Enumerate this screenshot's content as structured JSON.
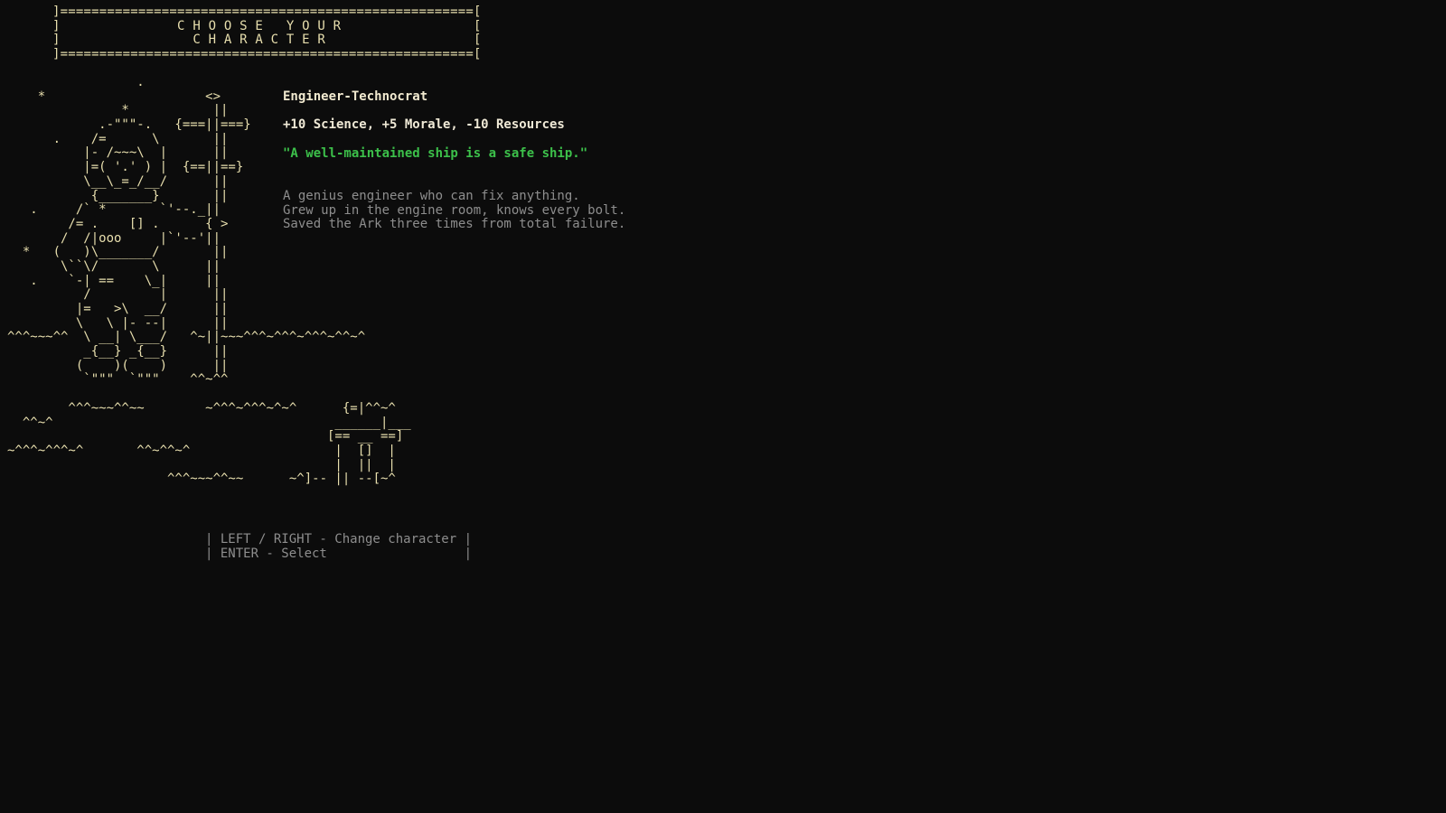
{
  "title_box": {
    "line1": "]=====================================================[",
    "line2": "]               C H O O S E   Y O U R                 [",
    "line3": "]                 C H A R A C T E R                   [",
    "line4": "]=====================================================["
  },
  "art": {
    "lines": [
      "                 .",
      "    *                     <>",
      "               *           ||",
      "            .-\"\"\"-.   {===||===}",
      "      .    /=      \\       ||",
      "          |- /~~~\\  |      ||",
      "          |=( '.' ) |  {==||==}",
      "          \\__\\_=_/__/      ||",
      "           {_______}       ||",
      "   .     /` *       `'--._||",
      "        /= .    [] .      { >",
      "       /  /|ooo     |`'--'||",
      "  *   (   )\\_______/       ||",
      "       \\``\\/       \\      ||",
      "   .    `-| ==    \\_|     ||",
      "          /         |      ||",
      "         |=   >\\  __/      ||",
      "         \\   \\ |- --|      ||",
      "^^^~~~^^  \\ __| \\___/   ^~||~~~^^^~^^^~^^^~^^~^",
      "          _{__} _{__}      ||",
      "         (    )(    )      ||",
      "          `\"\"\"  `\"\"\"    ^^~^^",
      "",
      "        ^^^~~~^^~~        ~^^^~^^^~^~^      {=|^^~^",
      "  ^^~^                                     ______|___",
      "                                          [== __ ==]",
      "~^^^~^^^~^       ^^~^^~^                   |  []  |",
      "                                           |  ||  |",
      "                     ^^^~~~^^~~      ~^]-- || --[~^"
    ]
  },
  "character": {
    "name": "Engineer-Technocrat",
    "stats": "+10 Science, +5 Morale, -10 Resources",
    "quote": "\"A well-maintained ship is a safe ship.\"",
    "description": [
      "A genius engineer who can fix anything.",
      "Grew up in the engine room, knows every bolt.",
      "Saved the Ark three times from total failure."
    ]
  },
  "controls": {
    "line1": "| LEFT / RIGHT - Change character |",
    "line2": "| ENTER - Select                  |"
  },
  "colors": {
    "background": "#0c0c0c",
    "ascii": "#e8dfae",
    "quote": "#3cc04a",
    "muted": "#8e8e8e"
  }
}
